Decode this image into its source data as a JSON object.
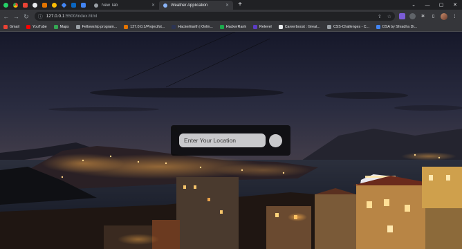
{
  "browser": {
    "tabs": [
      {
        "label": "New Tab",
        "active": false
      },
      {
        "label": "Weather Application",
        "active": true
      }
    ],
    "address": {
      "host": "127.0.0.1",
      "path": ":5500/index.html"
    },
    "bookmarks": [
      {
        "label": "Gmail",
        "color": "#ea4335"
      },
      {
        "label": "YouTube",
        "color": "#ff0000"
      },
      {
        "label": "Maps",
        "color": "#34a853"
      },
      {
        "label": "Fellowship program...",
        "color": "#9aa0a6"
      },
      {
        "label": "127.0.0.1/Project/st...",
        "color": "#e37400"
      },
      {
        "label": "HackerEarth | Onlin...",
        "color": "#2c3454"
      },
      {
        "label": "HackerRank",
        "color": "#1ba94c"
      },
      {
        "label": "Relevel",
        "color": "#5b3cc4"
      },
      {
        "label": "Careerboost : Great...",
        "color": "#e8eaed"
      },
      {
        "label": "CSS-Challenges - C...",
        "color": "#9aa0a6"
      },
      {
        "label": "DSA by Shradha Di...",
        "color": "#4285f4"
      }
    ]
  },
  "app": {
    "search": {
      "placeholder": "Enter Your Location"
    }
  },
  "colors": {
    "card_bg": "#0a0a0c",
    "input_bg": "#c9c9cc",
    "tab_active_bg": "#35363a",
    "chrome_bg": "#202124"
  },
  "icons": {
    "search_button": "magnifier-icon"
  }
}
